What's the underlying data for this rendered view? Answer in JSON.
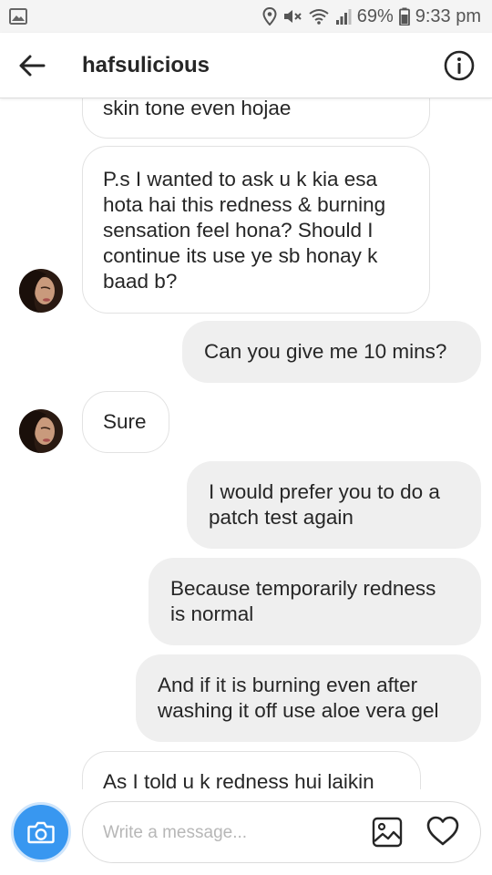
{
  "status_bar": {
    "battery": "69%",
    "time": "9:33 pm",
    "icons": [
      "image-notification-icon",
      "location-icon",
      "mute-icon",
      "wifi-icon",
      "signal-icon",
      "battery-icon"
    ]
  },
  "header": {
    "title": "hafsulicious",
    "back_icon": "back-arrow-icon",
    "info_icon": "info-icon"
  },
  "messages": [
    {
      "direction": "in",
      "text_lines": [
        "skin tone even hojae"
      ]
    },
    {
      "direction": "in",
      "text_lines": [
        "P.s I wanted to ask u k kia esa",
        "hota hai this redness & burning",
        "sensation feel hona? Should I",
        "continue its use ye sb honay k",
        "baad b?"
      ],
      "avatar": true
    },
    {
      "direction": "out",
      "text_lines": [
        "Can you give me 10 mins?"
      ]
    },
    {
      "direction": "in",
      "text_lines": [
        "Sure"
      ],
      "avatar": true
    },
    {
      "direction": "out",
      "text_lines": [
        "I would prefer you to do a",
        "patch test again"
      ]
    },
    {
      "direction": "out",
      "text_lines": [
        "Because temporarily redness",
        "is normal"
      ]
    },
    {
      "direction": "out",
      "text_lines": [
        "And if it is burning even after",
        "washing it off use aloe vera gel"
      ]
    },
    {
      "direction": "in",
      "text_lines": [
        "As I told u k redness hui laikin"
      ]
    }
  ],
  "composer": {
    "placeholder": "Write a message...",
    "camera_icon": "camera-icon",
    "gallery_icon": "gallery-icon",
    "like_icon": "heart-icon"
  },
  "colors": {
    "accent": "#3897f0",
    "outgoing_bubble": "#efefef",
    "incoming_border": "#e2e2e2"
  }
}
